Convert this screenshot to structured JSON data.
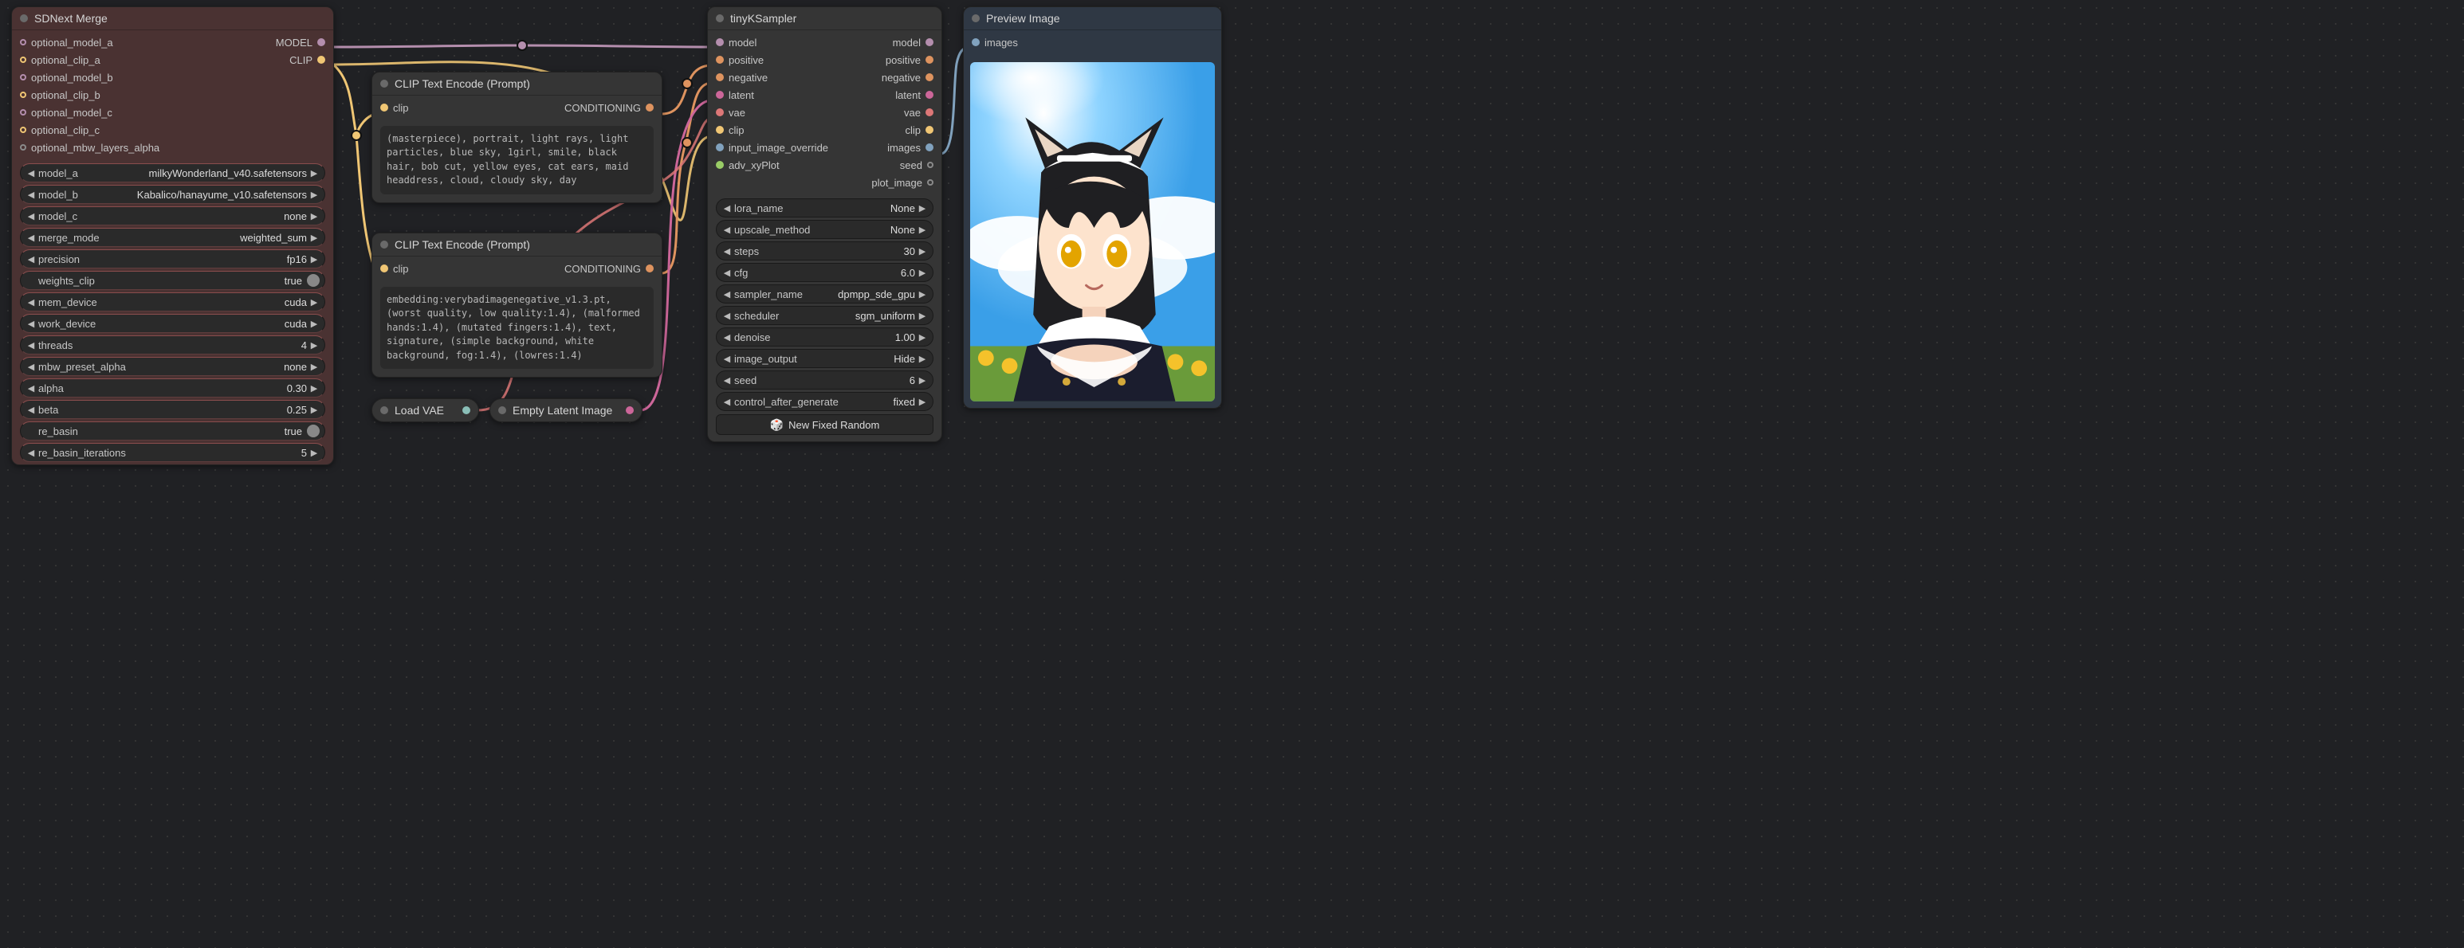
{
  "nodes": {
    "merge": {
      "title": "SDNext Merge",
      "inputs": [
        {
          "name": "optional_model_a",
          "color": "#b48ead"
        },
        {
          "name": "optional_clip_a",
          "color": "#f0c674"
        },
        {
          "name": "optional_model_b",
          "color": "#b48ead"
        },
        {
          "name": "optional_clip_b",
          "color": "#f0c674"
        },
        {
          "name": "optional_model_c",
          "color": "#b48ead"
        },
        {
          "name": "optional_clip_c",
          "color": "#f0c674"
        },
        {
          "name": "optional_mbw_layers_alpha",
          "color": "#8a8a8a"
        }
      ],
      "outputs": [
        {
          "name": "MODEL",
          "color": "#b48ead"
        },
        {
          "name": "CLIP",
          "color": "#f0c674"
        }
      ],
      "widgets": [
        {
          "key": "model_a",
          "value": "milkyWonderland_v40.safetensors",
          "type": "combo"
        },
        {
          "key": "model_b",
          "value": "Kabalico/hanayume_v10.safetensors",
          "type": "combo"
        },
        {
          "key": "model_c",
          "value": "none",
          "type": "combo"
        },
        {
          "key": "merge_mode",
          "value": "weighted_sum",
          "type": "combo"
        },
        {
          "key": "precision",
          "value": "fp16",
          "type": "combo"
        },
        {
          "key": "weights_clip",
          "value": "true",
          "type": "bool"
        },
        {
          "key": "mem_device",
          "value": "cuda",
          "type": "combo"
        },
        {
          "key": "work_device",
          "value": "cuda",
          "type": "combo"
        },
        {
          "key": "threads",
          "value": "4",
          "type": "num"
        },
        {
          "key": "mbw_preset_alpha",
          "value": "none",
          "type": "combo"
        },
        {
          "key": "alpha",
          "value": "0.30",
          "type": "num"
        },
        {
          "key": "beta",
          "value": "0.25",
          "type": "num"
        },
        {
          "key": "re_basin",
          "value": "true",
          "type": "bool"
        },
        {
          "key": "re_basin_iterations",
          "value": "5",
          "type": "num"
        }
      ]
    },
    "clip_pos": {
      "title": "CLIP Text Encode (Prompt)",
      "inputs": [
        {
          "name": "clip",
          "color": "#f0c674"
        }
      ],
      "outputs": [
        {
          "name": "CONDITIONING",
          "color": "#de935f"
        }
      ],
      "text": "(masterpiece), portrait, light rays, light particles, blue sky, 1girl, smile, black hair, bob cut, yellow eyes, cat ears, maid headdress, cloud, cloudy sky, day"
    },
    "clip_neg": {
      "title": "CLIP Text Encode (Prompt)",
      "inputs": [
        {
          "name": "clip",
          "color": "#f0c674"
        }
      ],
      "outputs": [
        {
          "name": "CONDITIONING",
          "color": "#de935f"
        }
      ],
      "text": "embedding:verybadimagenegative_v1.3.pt, (worst quality, low quality:1.4), (malformed hands:1.4), (mutated fingers:1.4), text, signature, (simple background, white background, fog:1.4), (lowres:1.4)"
    },
    "load_vae": {
      "title": "Load VAE",
      "out_color": "#8abeb7"
    },
    "empty_latent": {
      "title": "Empty Latent Image",
      "out_color": "#cc6699"
    },
    "sampler": {
      "title": "tinyKSampler",
      "inputs": [
        {
          "name": "model",
          "color": "#b48ead"
        },
        {
          "name": "positive",
          "color": "#de935f"
        },
        {
          "name": "negative",
          "color": "#de935f"
        },
        {
          "name": "latent",
          "color": "#cc6699"
        },
        {
          "name": "vae",
          "color": "#d77"
        },
        {
          "name": "clip",
          "color": "#f0c674"
        },
        {
          "name": "input_image_override",
          "color": "#81a2be"
        },
        {
          "name": "adv_xyPlot",
          "color": "#9c6"
        }
      ],
      "outputs": [
        {
          "name": "model",
          "color": "#b48ead"
        },
        {
          "name": "positive",
          "color": "#de935f"
        },
        {
          "name": "negative",
          "color": "#de935f"
        },
        {
          "name": "latent",
          "color": "#cc6699"
        },
        {
          "name": "vae",
          "color": "#d77"
        },
        {
          "name": "clip",
          "color": "#f0c674"
        },
        {
          "name": "images",
          "color": "#81a2be"
        },
        {
          "name": "seed",
          "color": "#8a8a8a"
        },
        {
          "name": "plot_image",
          "color": "#8a8a8a"
        }
      ],
      "widgets": [
        {
          "key": "lora_name",
          "value": "None",
          "type": "combo"
        },
        {
          "key": "upscale_method",
          "value": "None",
          "type": "combo"
        },
        {
          "key": "steps",
          "value": "30",
          "type": "num"
        },
        {
          "key": "cfg",
          "value": "6.0",
          "type": "num"
        },
        {
          "key": "sampler_name",
          "value": "dpmpp_sde_gpu",
          "type": "combo"
        },
        {
          "key": "scheduler",
          "value": "sgm_uniform",
          "type": "combo"
        },
        {
          "key": "denoise",
          "value": "1.00",
          "type": "num"
        },
        {
          "key": "image_output",
          "value": "Hide",
          "type": "combo"
        },
        {
          "key": "seed",
          "value": "6",
          "type": "num"
        },
        {
          "key": "control_after_generate",
          "value": "fixed",
          "type": "combo"
        }
      ],
      "button": "New Fixed Random"
    },
    "preview": {
      "title": "Preview Image",
      "inputs": [
        {
          "name": "images",
          "color": "#81a2be"
        }
      ]
    }
  }
}
